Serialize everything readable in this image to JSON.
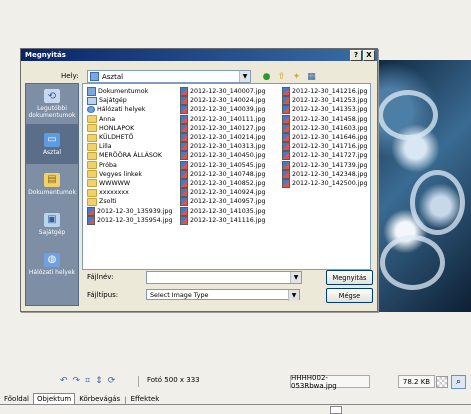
{
  "dialog": {
    "title": "Megnyitás",
    "help_button": "?",
    "close_button": "X",
    "look_in_label": "Hely:",
    "look_in_value": "Asztal",
    "places": [
      {
        "label": "Legutóbbi dokumentumok",
        "icon": "recent-docs-icon"
      },
      {
        "label": "Asztal",
        "icon": "desktop-icon"
      },
      {
        "label": "Dokumentumok",
        "icon": "documents-icon"
      },
      {
        "label": "Sajátgép",
        "icon": "computer-icon"
      },
      {
        "label": "Hálózati helyek",
        "icon": "network-icon"
      }
    ],
    "files_col1": [
      {
        "name": "Dokumentumok",
        "type": "doc"
      },
      {
        "name": "Sajátgép",
        "type": "pc"
      },
      {
        "name": "Hálózati helyek",
        "type": "net"
      },
      {
        "name": "Anna",
        "type": "folder"
      },
      {
        "name": "HONLAPOK",
        "type": "folder"
      },
      {
        "name": "KÜLDHETŐ",
        "type": "folder"
      },
      {
        "name": "Lilla",
        "type": "folder"
      },
      {
        "name": "MERÖÖRA ÁLLÁSOK",
        "type": "folder"
      },
      {
        "name": "Próba",
        "type": "folder"
      },
      {
        "name": "Vegyes linkek",
        "type": "folder"
      },
      {
        "name": "WWWWW",
        "type": "folder"
      },
      {
        "name": "xxxxxxxx",
        "type": "folder"
      },
      {
        "name": "Zsolti",
        "type": "folder"
      },
      {
        "name": "2012-12-30_135939.jpg",
        "type": "jpg"
      },
      {
        "name": "2012-12-30_135954.jpg",
        "type": "jpg"
      }
    ],
    "files_col2": [
      "2012-12-30_140007.jpg",
      "2012-12-30_140024.jpg",
      "2012-12-30_140039.jpg",
      "2012-12-30_140111.jpg",
      "2012-12-30_140127.jpg",
      "2012-12-30_140214.jpg",
      "2012-12-30_140313.jpg",
      "2012-12-30_140450.jpg",
      "2012-12-30_140545.jpg",
      "2012-12-30_140748.jpg",
      "2012-12-30_140852.jpg",
      "2012-12-30_140924.jpg",
      "2012-12-30_140957.jpg",
      "2012-12-30_141035.jpg",
      "2012-12-30_141116.jpg"
    ],
    "files_col3": [
      "2012-12-30_141216.jpg",
      "2012-12-30_141253.jpg",
      "2012-12-30_141353.jpg",
      "2012-12-30_141458.jpg",
      "2012-12-30_141603.jpg",
      "2012-12-30_141646.jpg",
      "2012-12-30_141716.jpg",
      "2012-12-30_141727.jpg",
      "2012-12-30_141739.jpg",
      "2012-12-30_142348.jpg",
      "2012-12-30_142500.jpg"
    ],
    "filename_label": "Fájlnév:",
    "filename_value": "",
    "filetype_label": "Fájltípus:",
    "filetype_value": "Select Image Type",
    "open_button": "Megnyitás",
    "cancel_button": "Mégse"
  },
  "statusbar": {
    "photo_info": "Fotó 500 x 333",
    "file_name": "HHHH002-053Rbwa.jpg",
    "file_size": "78.2 KB"
  },
  "tabs": [
    "Főoldal",
    "Objektum",
    "Körbevágás",
    "Effektek"
  ],
  "active_tab": "Objektum"
}
